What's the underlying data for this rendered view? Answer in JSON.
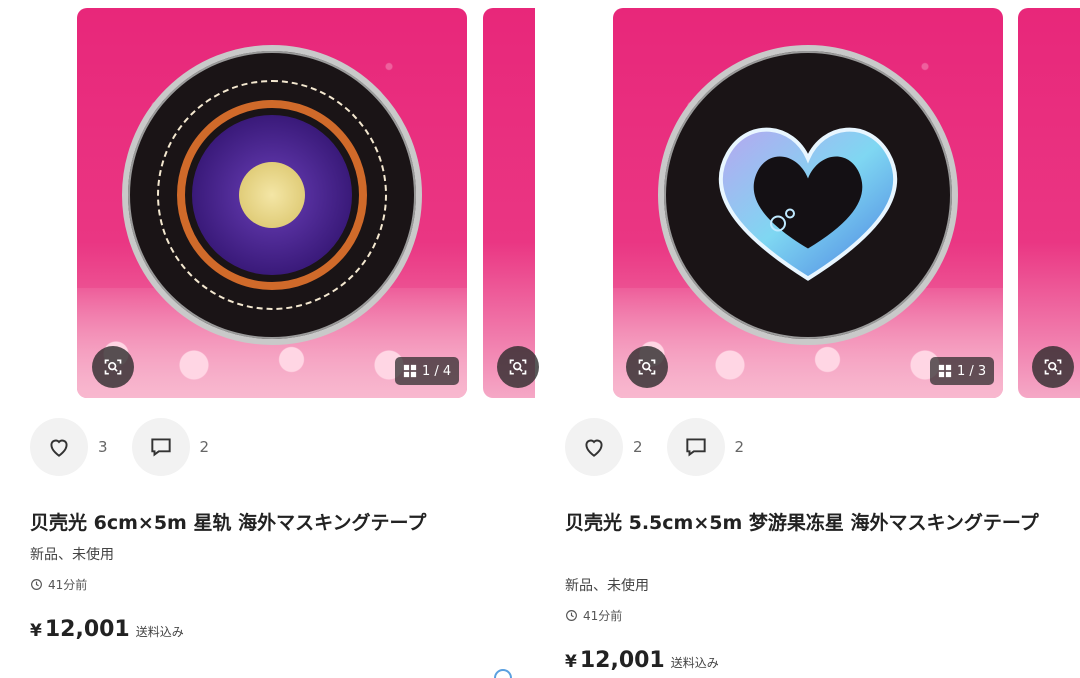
{
  "items": [
    {
      "image_counter": "1 / 4",
      "likes": "3",
      "comments": "2",
      "title": "贝壳光 6cm×5m 星轨 海外マスキングテープ",
      "condition": "新品、未使用",
      "time_ago": "41分前",
      "currency": "¥",
      "price": "12,001",
      "shipping": "送料込み"
    },
    {
      "image_counter": "1 / 3",
      "likes": "2",
      "comments": "2",
      "title": "贝壳光 5.5cm×5m 梦游果冻星 海外マスキングテープ",
      "condition": "新品、未使用",
      "time_ago": "41分前",
      "currency": "¥",
      "price": "12,001",
      "shipping": "送料込み"
    }
  ],
  "icons": {
    "image_search": "image-search-icon",
    "gallery": "gallery-grid-icon",
    "like": "heart-icon",
    "comment": "comment-icon",
    "clock": "clock-icon"
  },
  "colors": {
    "photo_background": "#e8277a",
    "action_circle": "#f2f2f2"
  }
}
